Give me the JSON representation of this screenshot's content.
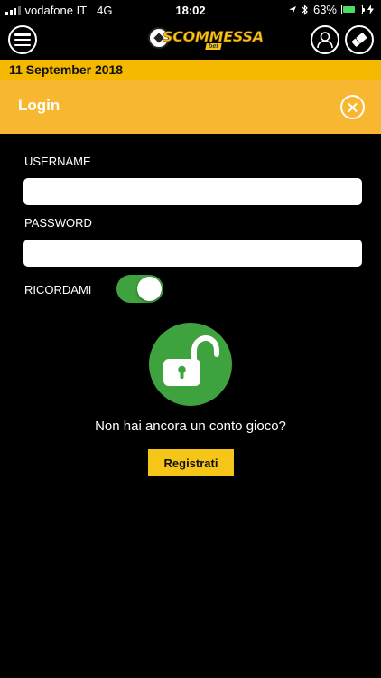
{
  "status_bar": {
    "carrier": "vodafone IT",
    "network": "4G",
    "time": "18:02",
    "battery": "63%",
    "battery_level": 0.63
  },
  "header": {
    "logo_text": "SCOMMESSA",
    "logo_sub": "bet",
    "icons": [
      "menu-icon",
      "user-icon",
      "bet-ticket-icon"
    ]
  },
  "date_bar": {
    "date": "11 September 2018"
  },
  "login": {
    "title": "Login",
    "username_label": "USERNAME",
    "username_value": "",
    "password_label": "PASSWORD",
    "password_value": "",
    "remember_label": "RICORDAMI",
    "remember_on": true,
    "signup_prompt": "Non hai ancora un conto gioco?",
    "register_label": "Registrati"
  },
  "colors": {
    "background": "#000000",
    "date_bar": "#f5b800",
    "login_header": "#f7b731",
    "accent_green": "#3ea33e",
    "button_yellow": "#f5c518"
  }
}
